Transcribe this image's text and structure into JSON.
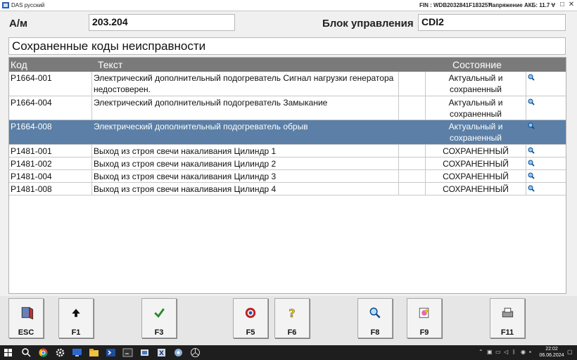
{
  "window": {
    "title": "DAS русский",
    "fin": "FIN : WDB2032841F183257",
    "voltage": "Напряжение АКБ: 11.7 V",
    "minimize": "–",
    "maximize": "□",
    "close": "✕"
  },
  "header": {
    "am_label": "А/м",
    "am_value": "203.204",
    "unit_label": "Блок управления",
    "unit_value": "CDI2"
  },
  "section_title": "Сохраненные коды неисправности",
  "table": {
    "columns": [
      "Код",
      "Текст",
      "Состояние"
    ],
    "rows": [
      {
        "code": "P1664-001",
        "text": "Электрический дополнительный подогреватель Сигнал нагрузки генератора недостоверен.",
        "state": "Актуальный и сохраненный",
        "selected": false
      },
      {
        "code": "P1664-004",
        "text": "Электрический дополнительный подогреватель Замыкание",
        "state": "Актуальный и сохраненный",
        "selected": false
      },
      {
        "code": "P1664-008",
        "text": "Электрический дополнительный подогреватель обрыв",
        "state": "Актуальный и сохраненный",
        "selected": true
      },
      {
        "code": "P1481-001",
        "text": "Выход из строя свечи накаливания Цилиндр 1",
        "state": "СОХРАНЕННЫЙ",
        "selected": false
      },
      {
        "code": "P1481-002",
        "text": "Выход из строя свечи накаливания Цилиндр 2",
        "state": "СОХРАНЕННЫЙ",
        "selected": false
      },
      {
        "code": "P1481-004",
        "text": "Выход из строя свечи накаливания Цилиндр 3",
        "state": "СОХРАНЕННЫЙ",
        "selected": false
      },
      {
        "code": "P1481-008",
        "text": "Выход из строя свечи накаливания Цилиндр 4",
        "state": "СОХРАНЕННЫЙ",
        "selected": false
      }
    ]
  },
  "toolbar": {
    "esc": "ESC",
    "f1": "F1",
    "f3": "F3",
    "f5": "F5",
    "f6": "F6",
    "f8": "F8",
    "f9": "F9",
    "f11": "F11"
  },
  "taskbar": {
    "time": "22:02",
    "date": "06.06.2024"
  },
  "colors": {
    "selected_row": "#5b7fa6",
    "header_bar": "#7a7a7a"
  }
}
